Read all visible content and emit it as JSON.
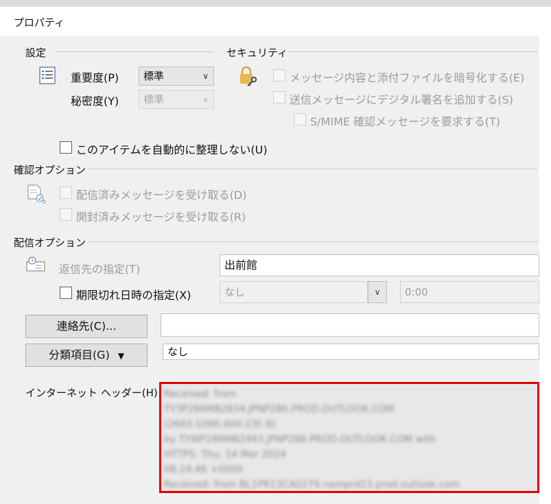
{
  "window": {
    "title": "プロパティ"
  },
  "settings": {
    "header": "設定",
    "importance_label": "重要度(P)",
    "importance_value": "標準",
    "sensitivity_label": "秘密度(Y)",
    "sensitivity_value": "標準",
    "no_autoarchive_label": "このアイテムを自動的に整理しない(U)"
  },
  "security": {
    "header": "セキュリティ",
    "encrypt_label": "メッセージ内容と添付ファイルを暗号化する(E)",
    "sign_label": "送信メッセージにデジタル署名を追加する(S)",
    "smime_label": "S/MIME 確認メッセージを要求する(T)"
  },
  "tracking": {
    "header": "確認オプション",
    "delivery_label": "配信済みメッセージを受け取る(D)",
    "read_label": "開封済みメッセージを受け取る(R)"
  },
  "delivery": {
    "header": "配信オプション",
    "reply_to_label": "返信先の指定(T)",
    "reply_to_value": "出前館",
    "expires_label": "期限切れ日時の指定(X)",
    "expires_date": "なし",
    "expires_time": "0:00"
  },
  "contacts": {
    "button_label": "連絡先(C)...",
    "value": ""
  },
  "categories": {
    "button_label": "分類項目(G)",
    "arrow": "▼",
    "value": "なし"
  },
  "internet_headers": {
    "label": "インターネット ヘッダー(H)",
    "lines": [
      "Received: from",
      "TY3P286MB2834.JPNP286.PROD.OUTLOOK.COM",
      "(2603:1096:400:23f::6)",
      " by TYWP286MB2493.JPNP286.PROD.OUTLOOK.COM with",
      "HTTPS; Thu, 14 Mar 2024",
      " 08:24:46 +0000",
      "Received: from BL1PR13CA0279.namprd13.prod.outlook.com"
    ]
  }
}
